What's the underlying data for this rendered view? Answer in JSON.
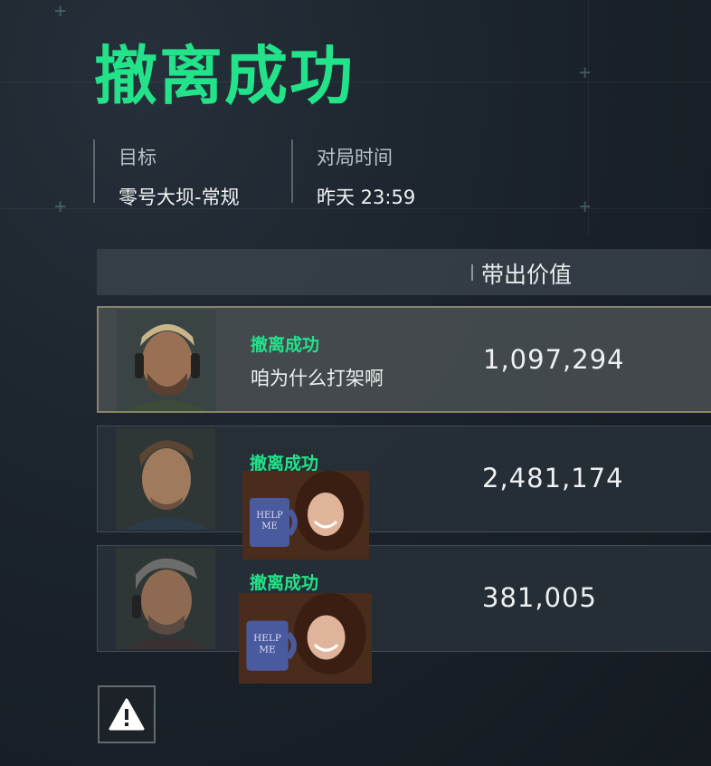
{
  "title": "撤离成功",
  "info": {
    "target_label": "目标",
    "target_value": "零号大坝-常规",
    "time_label": "对局时间",
    "time_value": "昨天 23:59"
  },
  "table": {
    "value_header": "带出价值"
  },
  "rows": [
    {
      "status": "撤离成功",
      "name": "咱为什么打架啊",
      "value": "1,097,294",
      "highlighted": true
    },
    {
      "status": "撤离成功",
      "name": "",
      "value": "2,481,174",
      "highlighted": false
    },
    {
      "status": "撤离成功",
      "name": "",
      "value": "381,005",
      "highlighted": false
    }
  ],
  "meme": {
    "mug_text": "HELP ME"
  },
  "icons": {
    "warning": "warning-icon"
  },
  "colors": {
    "accent_green": "#22e38a",
    "highlight_border": "#8a8369"
  }
}
